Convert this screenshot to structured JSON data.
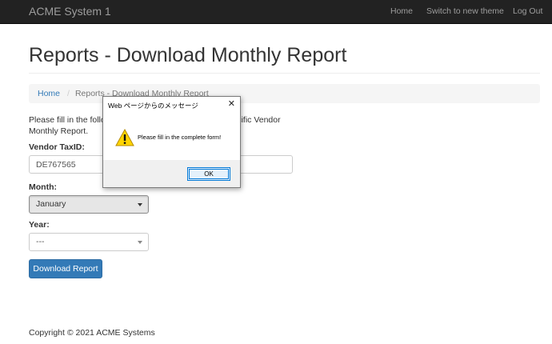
{
  "navbar": {
    "brand": "ACME System 1",
    "links": [
      "Home",
      "Switch to new theme",
      "Log Out"
    ]
  },
  "page": {
    "title": "Reports - Download Monthly Report",
    "breadcrumb": [
      "Home",
      "/",
      "Reports - Download Monthly Report"
    ]
  },
  "form": {
    "intro_line1": "Please fill in the following information to download a specific Vendor",
    "intro_line2": "Monthly Report.",
    "vendor_label": "Vendor TaxID:",
    "vendor_value": "DE767565",
    "month_label": "Month:",
    "month_value": "January",
    "year_label": "Year:",
    "year_value": "---",
    "submit_label": "Download Report"
  },
  "footer": {
    "text": "Copyright © 2021 ACME Systems"
  },
  "dialog": {
    "title": "Web ページからのメッセージ",
    "message": "Please fill in the complete form!",
    "ok_label": "OK",
    "close_glyph": "✕",
    "icon": "warning-icon"
  },
  "colors": {
    "navbar_bg": "#222222",
    "primary": "#337ab7",
    "link": "#337ab7",
    "warning": "#ffd500"
  }
}
